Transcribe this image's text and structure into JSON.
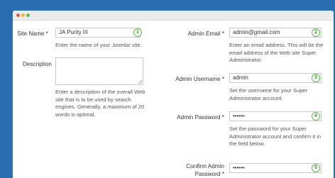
{
  "form": {
    "site_name": {
      "label": "Site Name *",
      "value": "JA Purity III",
      "help": "Enter the name of your Joomla! site.",
      "badge": "1"
    },
    "description": {
      "label": "Description",
      "value": "",
      "help_lines": [
        "Enter a description of the overall Web",
        "site that is to be used by search",
        "engines. Generally, a maximum of 20",
        "words is optimal."
      ]
    },
    "admin_email": {
      "label": "Admin Email *",
      "value": "admin@gmail.com",
      "help_lines": [
        "Enter an email address. This will be the",
        "email address of the Web site Super",
        "Administrator."
      ],
      "badge": "2"
    },
    "admin_username": {
      "label": "Admin Username *",
      "value": "admin",
      "help_lines": [
        "Set the username for your Super",
        "Administrator account."
      ],
      "badge": "3"
    },
    "admin_password": {
      "label": "Admin Password *",
      "value": "••••••",
      "help_lines": [
        "Set the password for your Super",
        "Administrator account and confirm it in",
        "the field below."
      ],
      "badge": "4"
    },
    "confirm_password": {
      "label_lines": [
        "Confirm Admin",
        "Password *"
      ],
      "value": "••••••",
      "badge": "5"
    }
  },
  "colors": {
    "background": "#2a6db0",
    "badge_border": "#5bb84a"
  }
}
